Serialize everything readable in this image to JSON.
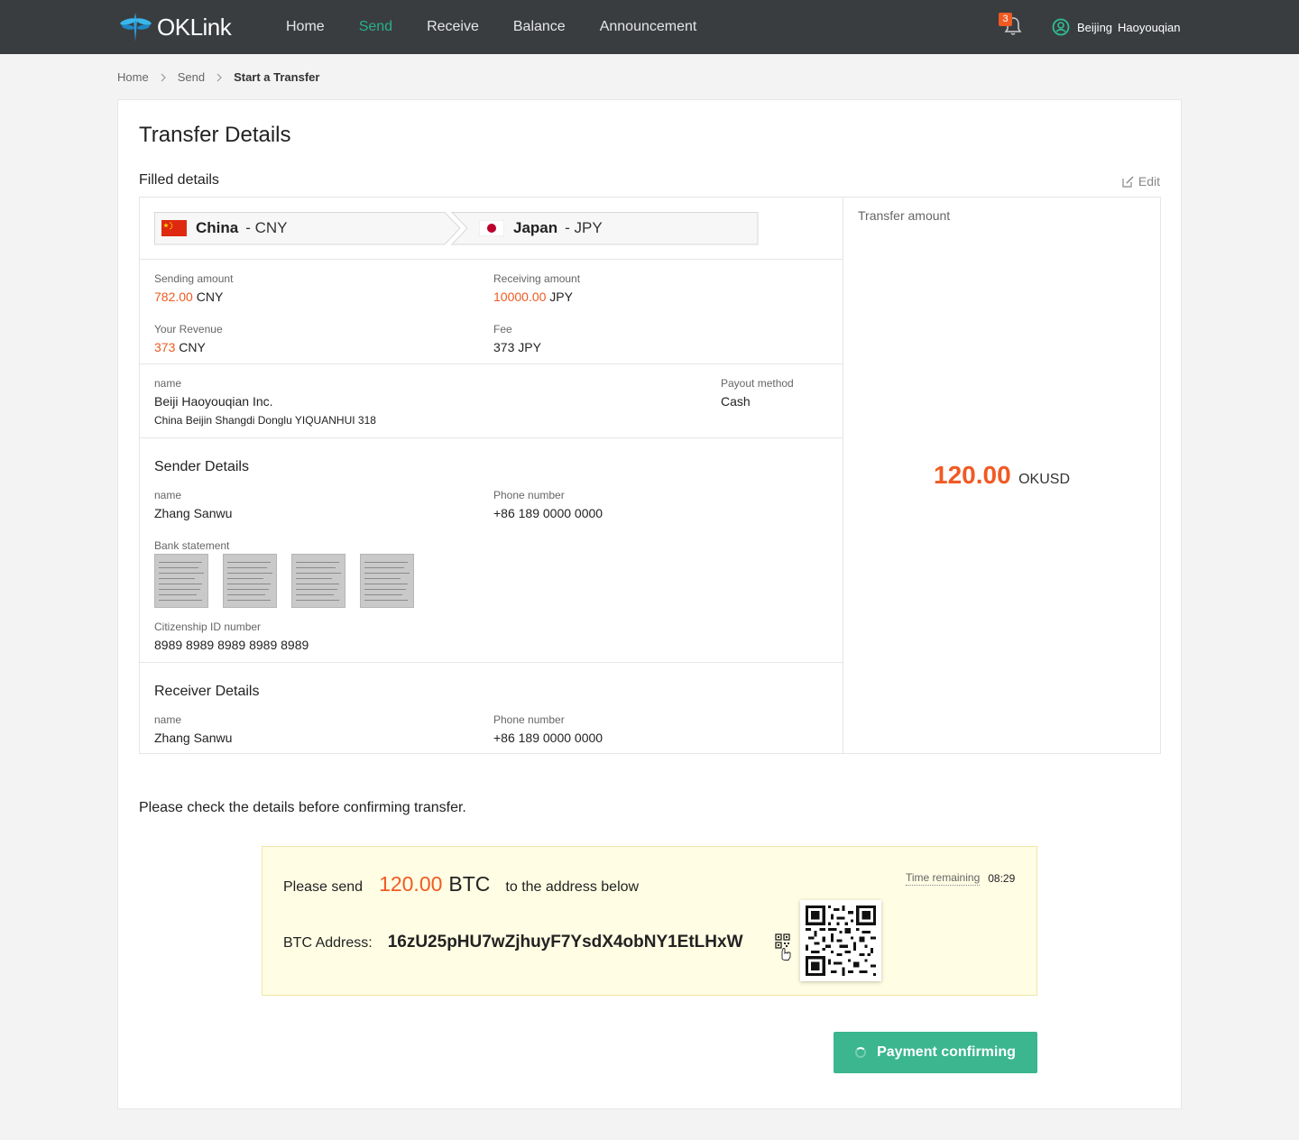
{
  "nav": {
    "logo_text": "OKLink",
    "items": [
      {
        "label": "Home",
        "active": false
      },
      {
        "label": "Send",
        "active": true
      },
      {
        "label": "Receive",
        "active": false
      },
      {
        "label": "Balance",
        "active": false
      },
      {
        "label": "Announcement",
        "active": false
      }
    ],
    "notification_count": "3",
    "user_first": "Beijing",
    "user_last": "Haoyouqian"
  },
  "breadcrumb": {
    "home": "Home",
    "send": "Send",
    "current": "Start a Transfer",
    "separator_icon": "chevron-right-icon"
  },
  "page": {
    "title": "Transfer Details",
    "filled_label": "Filled details",
    "edit_label": "Edit"
  },
  "route": {
    "from_country": "China",
    "from_currency": "- CNY",
    "to_country": "Japan",
    "to_currency": "- JPY"
  },
  "amounts": {
    "sending_label": "Sending amount",
    "sending_value": "782.00",
    "sending_currency": "CNY",
    "receiving_label": "Receiving amount",
    "receiving_value": "10000.00",
    "receiving_currency": "JPY",
    "revenue_label": "Your Revenue",
    "revenue_value": "373",
    "revenue_currency": "CNY",
    "fee_label": "Fee",
    "fee_value": "373 JPY"
  },
  "payee": {
    "name_label": "name",
    "name": "Beiji Haoyouqian Inc.",
    "address": "China  Beijin  Shangdi Donglu YIQUANHUI 318",
    "payout_label": "Payout method",
    "payout_value": "Cash"
  },
  "sender": {
    "title": "Sender Details",
    "name_label": "name",
    "name": "Zhang Sanwu",
    "phone_label": "Phone number",
    "phone": "+86 189 0000 0000",
    "bank_label": "Bank statement",
    "id_label": "Citizenship ID number",
    "id_value": "8989 8989 8989 8989 8989"
  },
  "receiver": {
    "title": "Receiver Details",
    "name_label": "name",
    "name": "Zhang Sanwu",
    "phone_label": "Phone number",
    "phone": "+86 189 0000 0000"
  },
  "summary": {
    "label": "Transfer amount",
    "value": "120.00",
    "unit": "OKUSD"
  },
  "check_note": "Please check the details before confirming transfer.",
  "payment": {
    "prefix": "Please send",
    "amount": "120.00",
    "currency": "BTC",
    "suffix": "to the address below",
    "time_label": "Time remaining",
    "time_value": "08:29",
    "address_label": "BTC Address:",
    "address": "16zU25pHU7wZjhuyF7YsdX4obNY1EtLHxW"
  },
  "confirm_button": "Payment confirming",
  "colors": {
    "accent_green": "#27b08a",
    "button_green": "#3bb68e",
    "highlight_orange": "#f05a23",
    "topbar": "#3a3d40",
    "pay_box_bg": "#fffde3"
  }
}
